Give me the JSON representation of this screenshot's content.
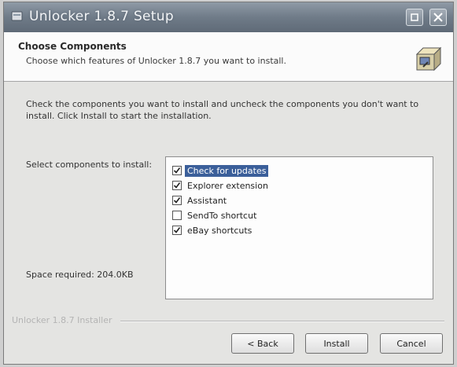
{
  "window": {
    "title": "Unlocker 1.8.7 Setup"
  },
  "header": {
    "title": "Choose Components",
    "subtitle": "Choose which features of Unlocker 1.8.7 you want to install."
  },
  "body": {
    "description": "Check the components you want to install and uncheck the components you don't want to install. Click Install to start the installation.",
    "select_label": "Select components to install:",
    "space_required": "Space required: 204.0KB"
  },
  "components": [
    {
      "label": "Check for updates",
      "checked": true,
      "selected": true
    },
    {
      "label": "Explorer extension",
      "checked": true,
      "selected": false
    },
    {
      "label": "Assistant",
      "checked": true,
      "selected": false
    },
    {
      "label": "SendTo shortcut",
      "checked": false,
      "selected": false
    },
    {
      "label": "eBay shortcuts",
      "checked": true,
      "selected": false
    }
  ],
  "footer": {
    "branding": "Unlocker 1.8.7 Installer",
    "back_label": "< Back",
    "install_label": "Install",
    "cancel_label": "Cancel"
  },
  "colors": {
    "selection": "#3b5f9a",
    "titlebar": "#6f7b88"
  }
}
